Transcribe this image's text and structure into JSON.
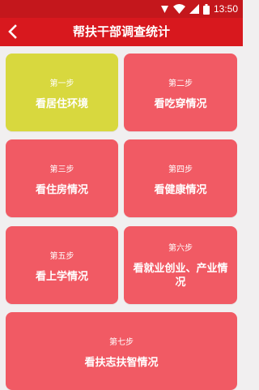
{
  "status_bar": {
    "time": "13:50",
    "icons": [
      "notification-icon",
      "wifi-icon",
      "signal-icon",
      "battery-icon"
    ]
  },
  "app_bar": {
    "title": "帮扶干部调查统计",
    "back_icon": "back-arrow-icon"
  },
  "colors": {
    "status_bar": "#c4171c",
    "app_bar": "#d8181e",
    "card": "#f15a64",
    "card_active": "#d8d83e",
    "background": "#f1eff0"
  },
  "steps": [
    {
      "step": "第一步",
      "label": "看居住环境"
    },
    {
      "step": "第二步",
      "label": "看吃穿情况"
    },
    {
      "step": "第三步",
      "label": "看住房情况"
    },
    {
      "step": "第四步",
      "label": "看健康情况"
    },
    {
      "step": "第五步",
      "label": "看上学情况"
    },
    {
      "step": "第六步",
      "label": "看就业创业、产业情况"
    },
    {
      "step": "第七步",
      "label": "看扶志扶智情况"
    }
  ]
}
